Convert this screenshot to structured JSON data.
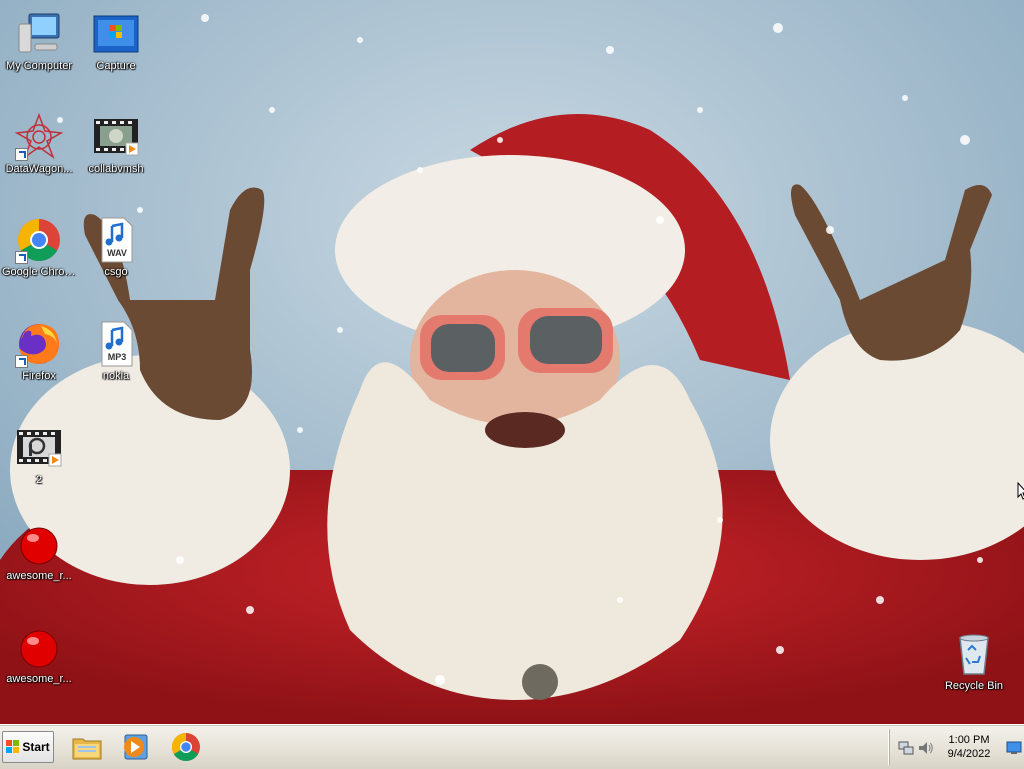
{
  "desktop": {
    "icons": [
      {
        "label": "My Computer",
        "icon": "my-computer-icon"
      },
      {
        "label": "Capture",
        "icon": "image-file-icon"
      },
      {
        "label": "DataWagon...",
        "icon": "datawagon-icon"
      },
      {
        "label": "collabvmsh",
        "icon": "video-file-icon"
      },
      {
        "label": "Google Chrome",
        "icon": "chrome-icon"
      },
      {
        "label": "csgo",
        "icon": "wav-file-icon",
        "badge": "WAV"
      },
      {
        "label": "Firefox",
        "icon": "firefox-icon"
      },
      {
        "label": "nokia",
        "icon": "mp3-file-icon",
        "badge": "MP3"
      },
      {
        "label": "2",
        "icon": "video-file-icon"
      },
      {
        "label": "awesome_r...",
        "icon": "red-ball-icon"
      },
      {
        "label": "awesome_r...",
        "icon": "red-ball-icon"
      },
      {
        "label": "Recycle Bin",
        "icon": "recycle-bin-icon"
      }
    ]
  },
  "taskbar": {
    "start_label": "Start",
    "pinned": [
      {
        "name": "file-explorer",
        "icon": "folder-icon"
      },
      {
        "name": "media-player",
        "icon": "media-player-icon"
      },
      {
        "name": "google-chrome",
        "icon": "chrome-icon"
      }
    ],
    "tray": {
      "time": "1:00 PM",
      "date": "9/4/2022"
    }
  },
  "colors": {
    "santa_red": "#b81c1f",
    "fur_white": "#f1ece4",
    "sky": "#a9c2d3",
    "taskbar": "#e5e1d6"
  }
}
